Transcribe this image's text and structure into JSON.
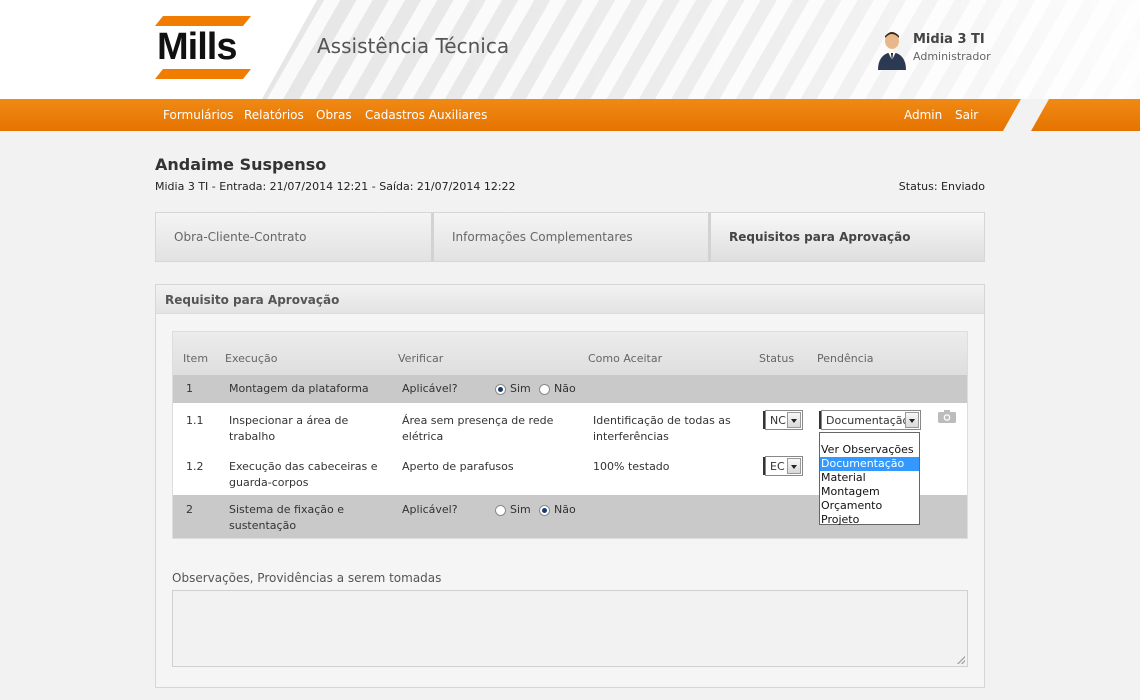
{
  "brand": {
    "logo_text": "Mills",
    "app_title": "Assistência Técnica",
    "accent": "#f07d00"
  },
  "user": {
    "name": "Midia 3 TI",
    "role": "Administrador"
  },
  "nav": {
    "left": [
      "Formulários",
      "Relatórios",
      "Obras",
      "Cadastros Auxiliares"
    ],
    "right": [
      "Admin",
      "Sair"
    ]
  },
  "page": {
    "title": "Andaime Suspenso",
    "subtitle": "Midia 3 TI - Entrada: 21/07/2014 12:21 - Saída: 21/07/2014 12:22",
    "status": "Status: Enviado"
  },
  "tabs": [
    "Obra-Cliente-Contrato",
    "Informações Complementares",
    "Requisitos para Aprovação"
  ],
  "panel": {
    "title": "Requisito para Aprovação"
  },
  "table": {
    "headers": [
      "Item",
      "Execução",
      "Verificar",
      "Como Aceitar",
      "Status",
      "Pendência"
    ],
    "rows": [
      {
        "item": "1",
        "execucao": "Montagem da plataforma",
        "verificar": "Aplicável?",
        "opt_yes": "Sim",
        "opt_no": "Não",
        "selected": "Sim"
      },
      {
        "item": "1.1",
        "execucao": "Inspecionar a área de trabalho",
        "verificar": "Área sem presença de rede elétrica",
        "como": "Identificação de todas as interferências",
        "status": "NC",
        "pendencia": "Documentação"
      },
      {
        "item": "1.2",
        "execucao": "Execução das cabeceiras e guarda-corpos",
        "verificar": "Aperto de parafusos",
        "como": "100% testado",
        "status": "EC"
      },
      {
        "item": "2",
        "execucao": "Sistema de fixação e sustentação",
        "verificar": "Aplicável?",
        "opt_yes": "Sim",
        "opt_no": "Não",
        "selected": "Não"
      }
    ]
  },
  "dropdown": {
    "options": [
      "Ver Observações",
      "Documentação",
      "Material",
      "Montagem",
      "Orçamento",
      "Projeto"
    ],
    "highlighted": "Documentação"
  },
  "observations": {
    "label": "Observações, Providências a serem tomadas",
    "value": ""
  }
}
